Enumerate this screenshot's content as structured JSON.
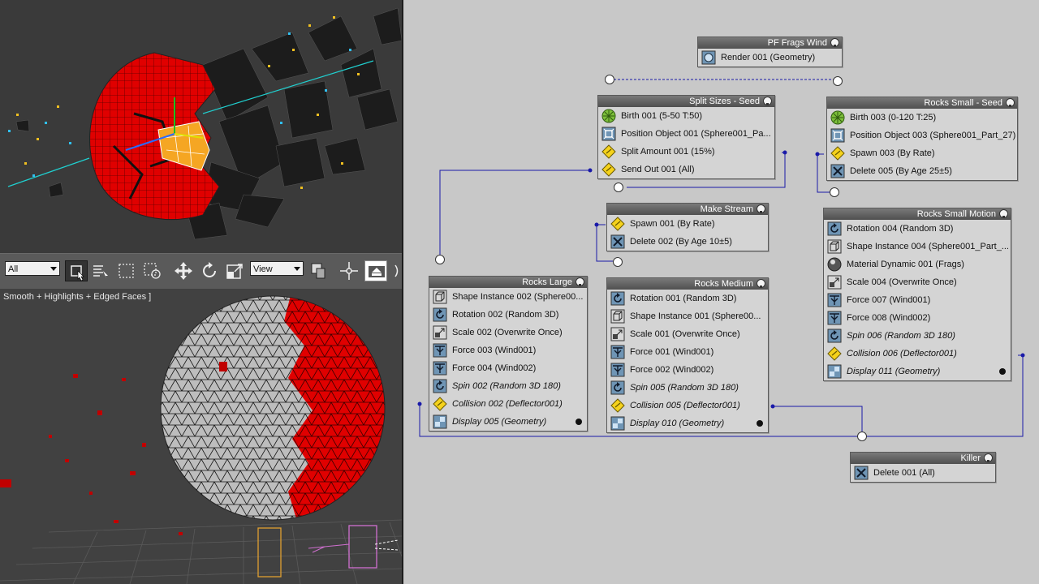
{
  "viewport_top": {
    "label": ""
  },
  "toolbar": {
    "selection_filter": "All",
    "reference_coord": "View"
  },
  "viewport_bottom": {
    "label": "Smooth + Highlights + Edged Faces ]"
  },
  "colors": {
    "wire": "#1a1aa8",
    "node_title": "#5a5a5a",
    "sphere_red": "#e00000",
    "sphere_grey": "#bdbdbd"
  },
  "pview": {
    "events": [
      {
        "id": "pf_frags_wind",
        "title": "PF Frags Wind",
        "ops": [
          {
            "label": "Render 001 (Geometry)",
            "icon": "render-icon"
          }
        ]
      },
      {
        "id": "split_sizes_seed",
        "title": "Split Sizes - Seed",
        "ops": [
          {
            "label": "Birth 001 (5-50 T:50)",
            "icon": "birth-icon"
          },
          {
            "label": "Position Object 001 (Sphere001_Pa...",
            "icon": "position-object-icon"
          },
          {
            "label": "Split Amount 001 (15%)",
            "icon": "test-diamond-icon"
          },
          {
            "label": "Send Out 001 (All)",
            "icon": "test-diamond-icon"
          }
        ]
      },
      {
        "id": "rocks_small_seed",
        "title": "Rocks Small - Seed",
        "ops": [
          {
            "label": "Birth 003 (0-120 T:25)",
            "icon": "birth-icon"
          },
          {
            "label": "Position Object 003 (Sphere001_Part_27)",
            "icon": "position-object-icon"
          },
          {
            "label": "Spawn 003 (By Rate)",
            "icon": "test-diamond-icon"
          },
          {
            "label": "Delete 005 (By Age 25±5)",
            "icon": "delete-icon"
          }
        ]
      },
      {
        "id": "make_stream",
        "title": "Make Stream",
        "ops": [
          {
            "label": "Spawn 001 (By Rate)",
            "icon": "test-diamond-icon"
          },
          {
            "label": "Delete 002 (By Age 10±5)",
            "icon": "delete-icon"
          }
        ]
      },
      {
        "id": "rocks_small_motion",
        "title": "Rocks Small Motion",
        "ops": [
          {
            "label": "Rotation 004 (Random 3D)",
            "icon": "rotation-icon"
          },
          {
            "label": "Shape Instance 004 (Sphere001_Part_...",
            "icon": "shape-instance-icon"
          },
          {
            "label": "Material Dynamic 001 (Frags)",
            "icon": "material-icon"
          },
          {
            "label": "Scale 004 (Overwrite Once)",
            "icon": "scale-icon"
          },
          {
            "label": "Force 007 (Wind001)",
            "icon": "force-icon"
          },
          {
            "label": "Force 008 (Wind002)",
            "icon": "force-icon"
          },
          {
            "label": "Spin 006 (Random 3D 180)",
            "icon": "spin-icon"
          },
          {
            "label": "Collision 006 (Deflector001)",
            "icon": "test-diamond-icon"
          },
          {
            "label": "Display 011 (Geometry)",
            "icon": "display-icon"
          }
        ]
      },
      {
        "id": "rocks_large",
        "title": "Rocks Large",
        "ops": [
          {
            "label": "Shape Instance 002 (Sphere00...",
            "icon": "shape-instance-icon"
          },
          {
            "label": "Rotation 002 (Random 3D)",
            "icon": "rotation-icon"
          },
          {
            "label": "Scale 002 (Overwrite Once)",
            "icon": "scale-icon"
          },
          {
            "label": "Force 003 (Wind001)",
            "icon": "force-icon"
          },
          {
            "label": "Force 004 (Wind002)",
            "icon": "force-icon"
          },
          {
            "label": "Spin 002 (Random 3D 180)",
            "icon": "spin-icon"
          },
          {
            "label": "Collision 002 (Deflector001)",
            "icon": "test-diamond-icon"
          },
          {
            "label": "Display 005 (Geometry)",
            "icon": "display-icon"
          }
        ]
      },
      {
        "id": "rocks_medium",
        "title": "Rocks Medium",
        "ops": [
          {
            "label": "Rotation 001 (Random 3D)",
            "icon": "rotation-icon"
          },
          {
            "label": "Shape Instance 001 (Sphere00...",
            "icon": "shape-instance-icon"
          },
          {
            "label": "Scale 001 (Overwrite Once)",
            "icon": "scale-icon"
          },
          {
            "label": "Force 001 (Wind001)",
            "icon": "force-icon"
          },
          {
            "label": "Force 002 (Wind002)",
            "icon": "force-icon"
          },
          {
            "label": "Spin 005 (Random 3D 180)",
            "icon": "spin-icon"
          },
          {
            "label": "Collision 005 (Deflector001)",
            "icon": "test-diamond-icon"
          },
          {
            "label": "Display 010 (Geometry)",
            "icon": "display-icon"
          }
        ]
      },
      {
        "id": "killer",
        "title": "Killer",
        "ops": [
          {
            "label": "Delete 001 (All)",
            "icon": "delete-icon"
          }
        ]
      }
    ]
  }
}
